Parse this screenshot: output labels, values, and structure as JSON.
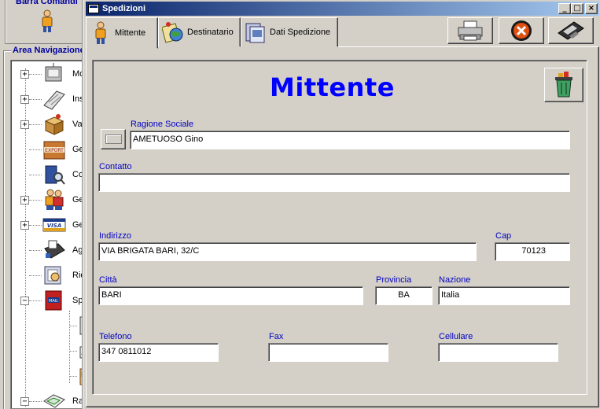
{
  "background": {
    "toolbar_title": "Barra Comandi",
    "nav_title": "Area Navigazione",
    "tree_items": [
      {
        "expander": "+",
        "icon": "monitor-icon",
        "label": "Mo"
      },
      {
        "expander": "+",
        "icon": "keyboard-icon",
        "label": "Ins"
      },
      {
        "expander": "+",
        "icon": "box-icon",
        "label": "Va"
      },
      {
        "expander": "",
        "icon": "export-icon",
        "label": "Ge"
      },
      {
        "expander": "",
        "icon": "computer-search-icon",
        "label": "Co"
      },
      {
        "expander": "+",
        "icon": "people-icon",
        "label": "Ge"
      },
      {
        "expander": "+",
        "icon": "visa-card-icon",
        "label": "Ge"
      },
      {
        "expander": "",
        "icon": "fax-icon",
        "label": "Ag"
      },
      {
        "expander": "",
        "icon": "book-icon",
        "label": "Rie"
      },
      {
        "expander": "−",
        "icon": "mail-icon",
        "label": "Sp"
      },
      {
        "expander": "−",
        "icon": "handshake-icon",
        "label": "Ra"
      }
    ]
  },
  "window": {
    "title": "Spedizioni",
    "controls": {
      "minimize": "_",
      "maximize": "□",
      "close": "×"
    }
  },
  "tabs": [
    {
      "label": "Mittente",
      "icon": "person-icon",
      "active": true
    },
    {
      "label": "Destinatario",
      "icon": "globe-icon",
      "active": false
    },
    {
      "label": "Dati Spedizione",
      "icon": "documents-icon",
      "active": false
    }
  ],
  "toolbar_buttons": [
    {
      "name": "print",
      "icon": "printer-icon"
    },
    {
      "name": "cancel",
      "icon": "cancel-icon"
    },
    {
      "name": "save",
      "icon": "floppy-disk-icon"
    }
  ],
  "form": {
    "heading": "Mittente",
    "ragione_sociale": {
      "label": "Ragione Sociale",
      "value": "AMETUOSO Gino"
    },
    "contatto": {
      "label": "Contatto",
      "value": ""
    },
    "indirizzo": {
      "label": "Indirizzo",
      "value": "VIA BRIGATA BARI, 32/C"
    },
    "cap": {
      "label": "Cap",
      "value": "70123"
    },
    "citta": {
      "label": "Città",
      "value": "BARI"
    },
    "provincia": {
      "label": "Provincia",
      "value": "BA"
    },
    "nazione": {
      "label": "Nazione",
      "value": "Italia"
    },
    "telefono": {
      "label": "Telefono",
      "value": "347 0811012"
    },
    "fax": {
      "label": "Fax",
      "value": ""
    },
    "cellulare": {
      "label": "Cellulare",
      "value": ""
    }
  },
  "colors": {
    "face": "#d4d0c8",
    "label_blue": "#0000c0",
    "heading_blue": "#0000ff",
    "title_gradient_start": "#0a246a",
    "title_gradient_end": "#a6caf0"
  }
}
